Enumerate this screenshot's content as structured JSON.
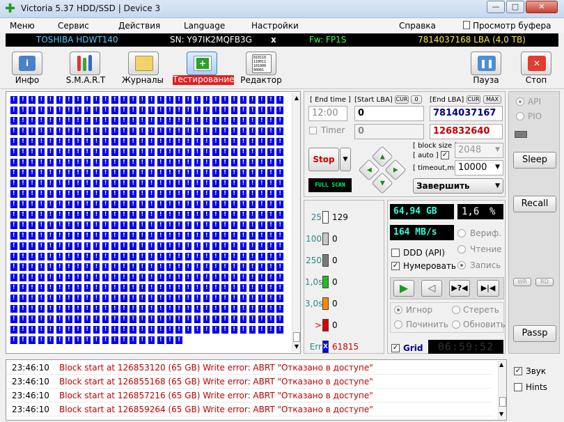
{
  "window": {
    "title": "Victoria 5.37 HDD/SSD | Device 3",
    "minimize": "—",
    "maximize": "□",
    "close": "✕"
  },
  "menu": [
    "Меню",
    "Сервис",
    "Действия",
    "Language",
    "Настройки",
    "Справка"
  ],
  "buffer_view": "Просмотр буфера",
  "drive": {
    "model": "TOSHIBA HDWT140",
    "serial": "SN: Y97IK2MQFB3G",
    "x": "x",
    "firmware": "Fw: FP1S",
    "capacity": "7814037168 LBA (4,0 TB)"
  },
  "toolbar": {
    "info": "Инфо",
    "smart": "S.M.A.R.T",
    "journals": "Журналы",
    "testing": "Тестирование",
    "editor": "Редактор",
    "pause": "Пауза",
    "stop": "Стоп",
    "editor_icon_text": "010110\n110011\n101000\n00001"
  },
  "test": {
    "end_time_label": "[ End time ]",
    "start_lba_label": "[Start LBA]",
    "cur": "CUR",
    "zero": "0",
    "end_lba_label": "[End LBA]",
    "max": "MAX",
    "time_value": "12:00",
    "start_lba": "0",
    "end_lba": "7814037167",
    "timer_label": "Timer",
    "timer_value": "0",
    "current_lba": "126832640",
    "stop_button": "Stop",
    "block_size_label": "[ block size ]",
    "auto_label": "[ auto ]",
    "block_size": "2048",
    "timeout_label": "[ timeout,ms ]",
    "timeout": "10000",
    "finish_option": "Завершить",
    "full_scan": "FULL SCAN"
  },
  "stats": {
    "rows": [
      {
        "label": "25",
        "count": "129",
        "color": "#ffffff"
      },
      {
        "label": "100",
        "count": "0",
        "color": "#c8c8c8"
      },
      {
        "label": "250",
        "count": "0",
        "color": "#7a7a7a"
      },
      {
        "label": "1,0s",
        "count": "0",
        "color": "#22bb22"
      },
      {
        "label": "3,0s",
        "count": "0",
        "color": "#ff8800"
      },
      {
        "label": ">",
        "count": "0",
        "color": "#dd0000"
      },
      {
        "label": "Err",
        "count": "61815",
        "color": "#0000ee"
      }
    ],
    "err_mark": "X",
    "size": "64,94 GB",
    "percent": "1,6",
    "percent_sign": "%",
    "speed": "164 MB/s",
    "verify": "Вериф.",
    "read": "Чтение",
    "write": "Запись",
    "ddd": "DDD (API)",
    "numerate": "Нумеровать",
    "ignore": "Игнор",
    "erase": "Стереть",
    "repair": "Починить",
    "refresh": "Обновить",
    "grid": "Grid",
    "clock": "06:59:52"
  },
  "side": {
    "api": "API",
    "pio": "PIO",
    "sleep": "Sleep",
    "recall": "Recall",
    "wr": "WR",
    "rd": "RD",
    "passp": "Passp",
    "sound": "Звук",
    "hints": "Hints"
  },
  "map_cell_glyph": "!",
  "log": [
    {
      "time": "23:46:10",
      "msg": "Block start at 126853120 (65 GB) Write error: ABRT \"Отказано в доступе\""
    },
    {
      "time": "23:46:10",
      "msg": "Block start at 126855168 (65 GB) Write error: ABRT \"Отказано в доступе\""
    },
    {
      "time": "23:46:10",
      "msg": "Block start at 126857216 (65 GB) Write error: ABRT \"Отказано в доступе\""
    },
    {
      "time": "23:46:10",
      "msg": "Block start at 126859264 (65 GB) Write error: ABRT \"Отказано в доступе\""
    }
  ]
}
